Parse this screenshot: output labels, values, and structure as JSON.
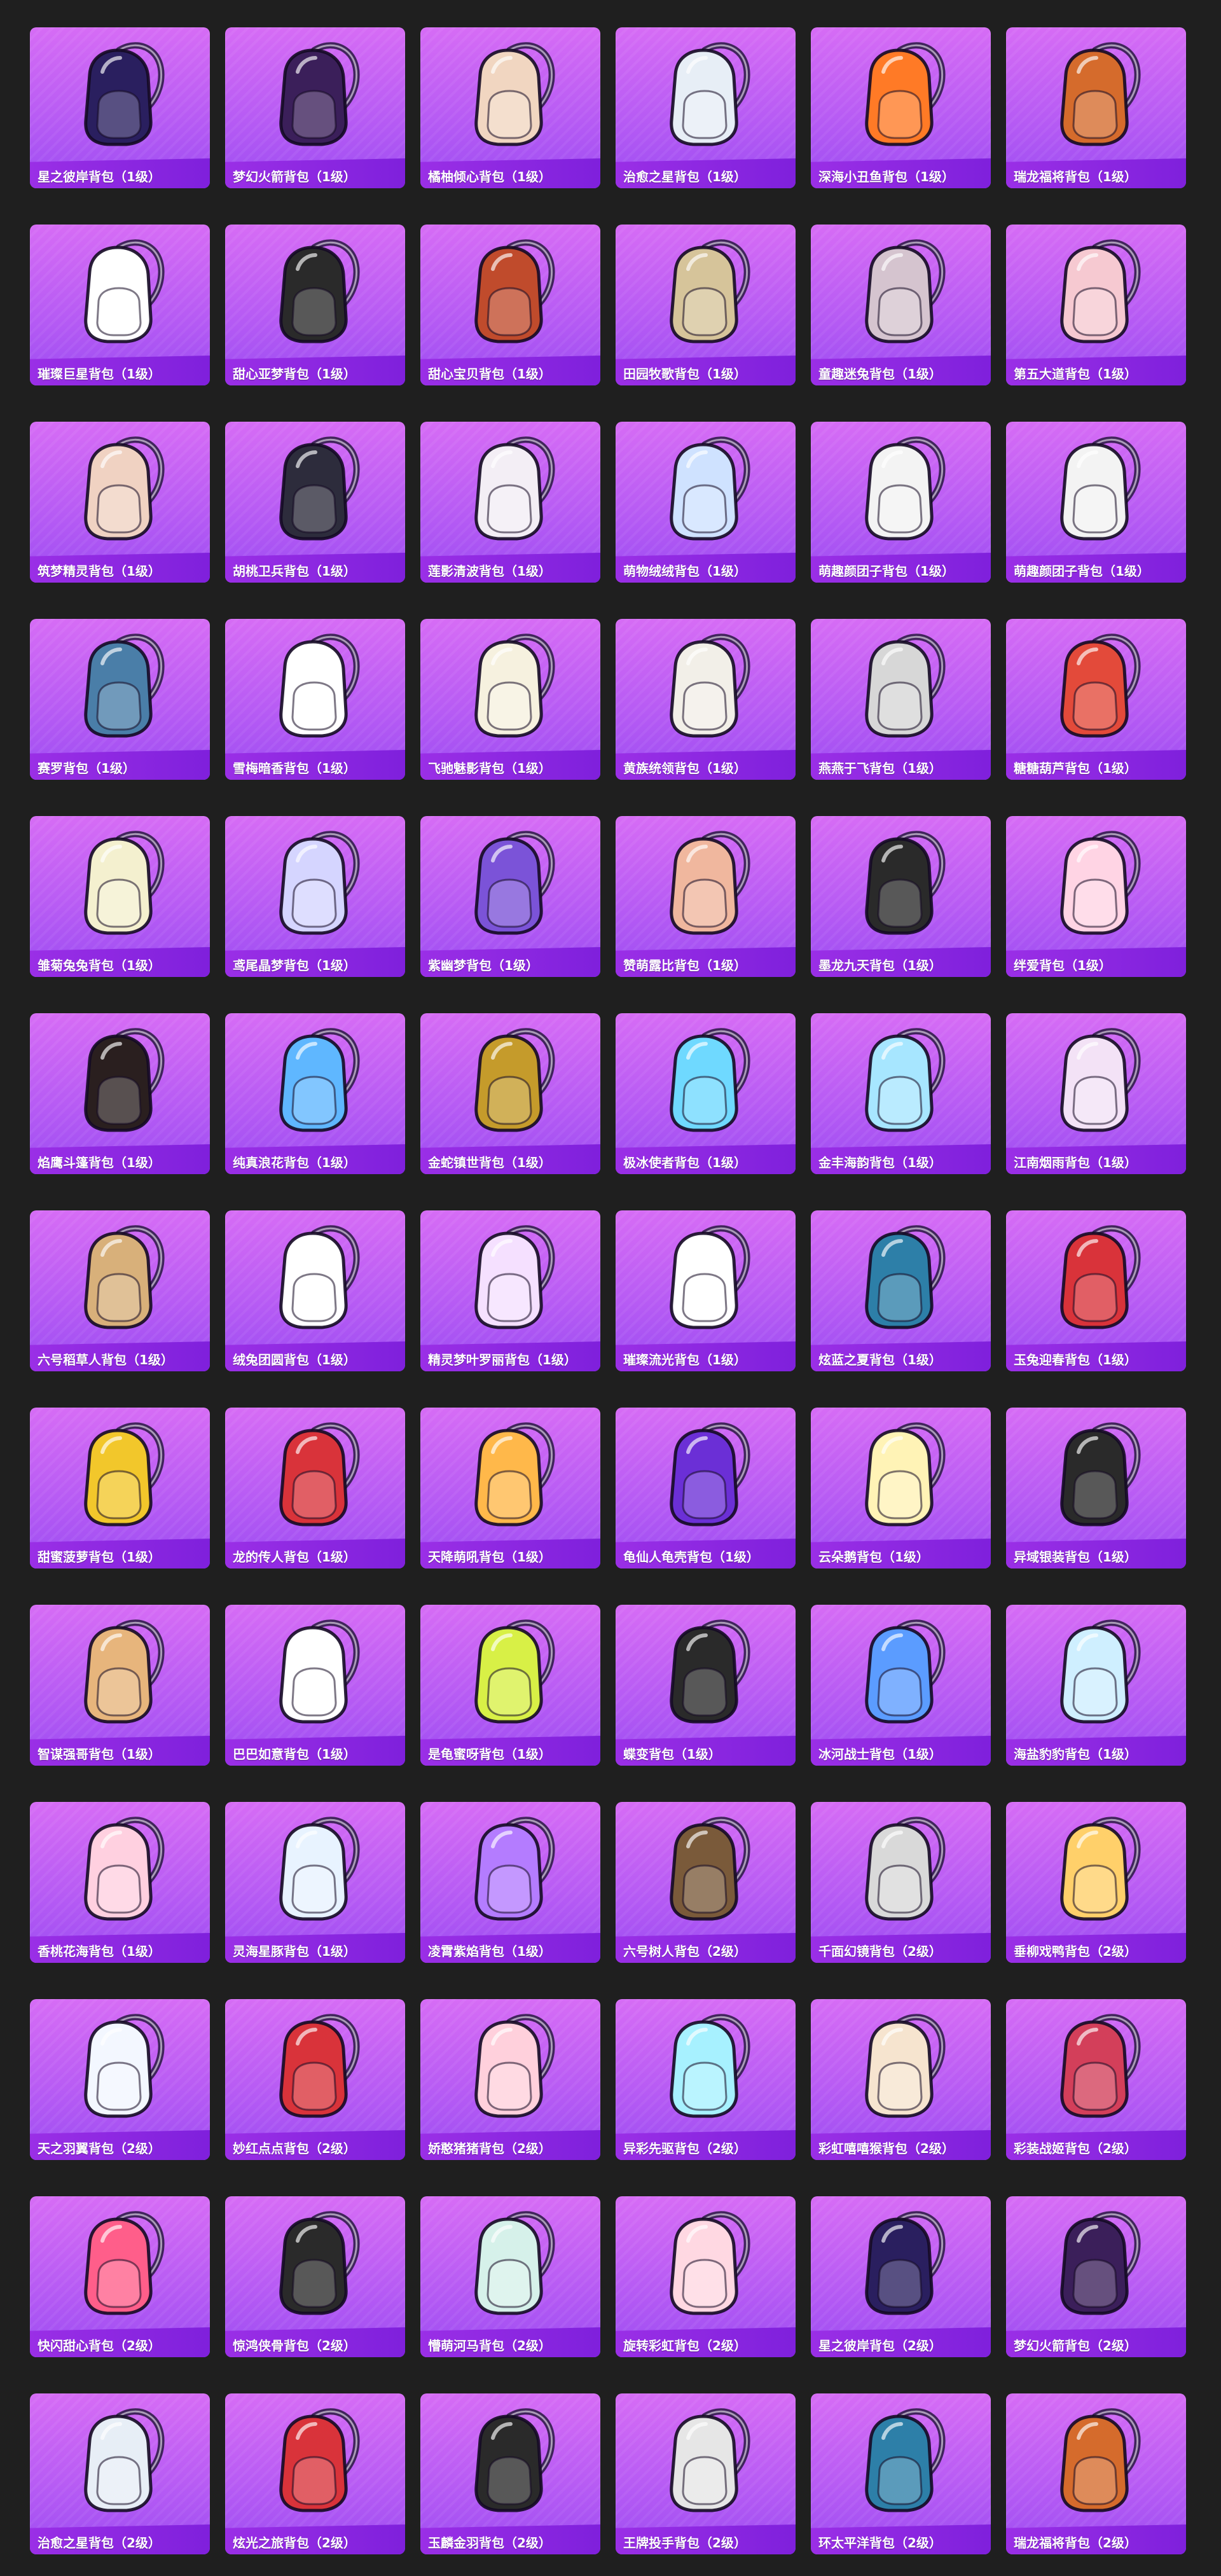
{
  "app": {
    "title": ""
  },
  "items": [
    {
      "label": "星之彼岸背包（1级）",
      "icon": "backpack-icon",
      "color": "#2a1f5f"
    },
    {
      "label": "梦幻火箭背包（1级）",
      "icon": "backpack-icon",
      "color": "#3b1f5a"
    },
    {
      "label": "橘柚倾心背包（1级）",
      "icon": "backpack-icon",
      "color": "#f1d6c1"
    },
    {
      "label": "治愈之星背包（1级）",
      "icon": "backpack-icon",
      "color": "#e7eef6"
    },
    {
      "label": "深海小丑鱼背包（1级）",
      "icon": "backpack-icon",
      "color": "#ff7a26"
    },
    {
      "label": "瑞龙福将背包（1级）",
      "icon": "backpack-icon",
      "color": "#d56b2c"
    },
    {
      "label": "璀璨巨星背包（1级）",
      "icon": "backpack-icon",
      "color": "#ffffff"
    },
    {
      "label": "甜心亚梦背包（1级）",
      "icon": "backpack-icon",
      "color": "#2a2a2a"
    },
    {
      "label": "甜心宝贝背包（1级）",
      "icon": "backpack-icon",
      "color": "#c04b2c"
    },
    {
      "label": "田园牧歌背包（1级）",
      "icon": "backpack-icon",
      "color": "#d6c49a"
    },
    {
      "label": "童趣迷兔背包（1级）",
      "icon": "backpack-icon",
      "color": "#d5c4cf"
    },
    {
      "label": "第五大道背包（1级）",
      "icon": "backpack-icon",
      "color": "#f6c9d1"
    },
    {
      "label": "筑梦精灵背包（1级）",
      "icon": "backpack-icon",
      "color": "#f0d2c2"
    },
    {
      "label": "胡桃卫兵背包（1级）",
      "icon": "backpack-icon",
      "color": "#2d2c3c"
    },
    {
      "label": "莲影清波背包（1级）",
      "icon": "backpack-icon",
      "color": "#f3eef5"
    },
    {
      "label": "萌物绒绒背包（1级）",
      "icon": "backpack-icon",
      "color": "#cfe2ff"
    },
    {
      "label": "萌趣颜团子背包（1级）",
      "icon": "backpack-icon",
      "color": "#f3f3f3"
    },
    {
      "label": "萌趣颜团子背包（1级）",
      "icon": "backpack-icon",
      "color": "#f3f3f3"
    },
    {
      "label": "赛罗背包（1级）",
      "icon": "backpack-icon",
      "color": "#4a7ea8"
    },
    {
      "label": "雪梅暗香背包（1级）",
      "icon": "backpack-icon",
      "color": "#ffffff"
    },
    {
      "label": "飞驰魅影背包（1级）",
      "icon": "backpack-icon",
      "color": "#f6f1df"
    },
    {
      "label": "黄族统领背包（1级）",
      "icon": "backpack-icon",
      "color": "#f2efe8"
    },
    {
      "label": "燕燕于飞背包（1级）",
      "icon": "backpack-icon",
      "color": "#d7d7d7"
    },
    {
      "label": "糖糖葫芦背包（1级）",
      "icon": "backpack-icon",
      "color": "#e34a3a"
    },
    {
      "label": "雏菊兔兔背包（1级）",
      "icon": "backpack-icon",
      "color": "#f4f0cf"
    },
    {
      "label": "鸢尾晶梦背包（1级）",
      "icon": "backpack-icon",
      "color": "#d5d5ff"
    },
    {
      "label": "紫幽梦背包（1级）",
      "icon": "backpack-icon",
      "color": "#7b53d8"
    },
    {
      "label": "赞萌露比背包（1级）",
      "icon": "backpack-icon",
      "color": "#f0b79e"
    },
    {
      "label": "墨龙九天背包（1级）",
      "icon": "backpack-icon",
      "color": "#2a2a2a"
    },
    {
      "label": "绊爱背包（1级）",
      "icon": "backpack-icon",
      "color": "#ffd4e4"
    },
    {
      "label": "焰鹰斗篷背包（1级）",
      "icon": "backpack-icon",
      "color": "#2a1f1f"
    },
    {
      "label": "纯真浪花背包（1级）",
      "icon": "backpack-icon",
      "color": "#5fb7ff"
    },
    {
      "label": "金蛇镇世背包（1级）",
      "icon": "backpack-icon",
      "color": "#c59b2b"
    },
    {
      "label": "极冰使者背包（1级）",
      "icon": "backpack-icon",
      "color": "#6fd9ff"
    },
    {
      "label": "金丰海韵背包（1级）",
      "icon": "backpack-icon",
      "color": "#a7e6ff"
    },
    {
      "label": "江南烟雨背包（1级）",
      "icon": "backpack-icon",
      "color": "#f3e2f6"
    },
    {
      "label": "六号稻草人背包（1级）",
      "icon": "backpack-icon",
      "color": "#d8b07a"
    },
    {
      "label": "绒兔团圆背包（1级）",
      "icon": "backpack-icon",
      "color": "#ffffff"
    },
    {
      "label": "精灵梦叶罗丽背包（1级）",
      "icon": "backpack-icon",
      "color": "#f5e0ff"
    },
    {
      "label": "璀璨流光背包（1级）",
      "icon": "backpack-icon",
      "color": "#ffffff"
    },
    {
      "label": "炫蓝之夏背包（1级）",
      "icon": "backpack-icon",
      "color": "#2d7fa8"
    },
    {
      "label": "玉兔迎春背包（1级）",
      "icon": "backpack-icon",
      "color": "#d9333a"
    },
    {
      "label": "甜蜜菠萝背包（1级）",
      "icon": "backpack-icon",
      "color": "#f2c72b"
    },
    {
      "label": "龙的传人背包（1级）",
      "icon": "backpack-icon",
      "color": "#d9333a"
    },
    {
      "label": "天降萌吼背包（1级）",
      "icon": "backpack-icon",
      "color": "#ffb84a"
    },
    {
      "label": "龟仙人龟壳背包（1级）",
      "icon": "backpack-icon",
      "color": "#6b2fd6"
    },
    {
      "label": "云朵鹅背包（1级）",
      "icon": "backpack-icon",
      "color": "#fff3b6"
    },
    {
      "label": "异域银装背包（1级）",
      "icon": "backpack-icon",
      "color": "#2a2a2a"
    },
    {
      "label": "智谋强哥背包（1级）",
      "icon": "backpack-icon",
      "color": "#e7b57c"
    },
    {
      "label": "巴巴如意背包（1级）",
      "icon": "backpack-icon",
      "color": "#ffffff"
    },
    {
      "label": "是龟蜜呀背包（1级）",
      "icon": "backpack-icon",
      "color": "#d8f046"
    },
    {
      "label": "蝶变背包（1级）",
      "icon": "backpack-icon",
      "color": "#2a2a2a"
    },
    {
      "label": "冰河战士背包（1级）",
      "icon": "backpack-icon",
      "color": "#5b9cff"
    },
    {
      "label": "海盐豹豹背包（1级）",
      "icon": "backpack-icon",
      "color": "#cfefff"
    },
    {
      "label": "香桃花海背包（1级）",
      "icon": "backpack-icon",
      "color": "#ffd0e0"
    },
    {
      "label": "灵海星豚背包（1级）",
      "icon": "backpack-icon",
      "color": "#e8f3ff"
    },
    {
      "label": "凌霄紫焰背包（1级）",
      "icon": "backpack-icon",
      "color": "#b47cff"
    },
    {
      "label": "六号树人背包（2级）",
      "icon": "backpack-icon",
      "color": "#7a5a3a"
    },
    {
      "label": "千面幻镜背包（2级）",
      "icon": "backpack-icon",
      "color": "#d9d9d9"
    },
    {
      "label": "垂柳戏鸭背包（2级）",
      "icon": "backpack-icon",
      "color": "#ffd06a"
    },
    {
      "label": "天之羽翼背包（2级）",
      "icon": "backpack-icon",
      "color": "#f3f7ff"
    },
    {
      "label": "妙红点点背包（2级）",
      "icon": "backpack-icon",
      "color": "#d9333a"
    },
    {
      "label": "娇憨猪猪背包（2级）",
      "icon": "backpack-icon",
      "color": "#ffd0dc"
    },
    {
      "label": "异彩先驱背包（2级）",
      "icon": "backpack-icon",
      "color": "#a7f1ff"
    },
    {
      "label": "彩虹嘻嘻猴背包（2级）",
      "icon": "backpack-icon",
      "color": "#f6e4cf"
    },
    {
      "label": "彩装战姬背包（2级）",
      "icon": "backpack-icon",
      "color": "#d33f5a"
    },
    {
      "label": "快闪甜心背包（2级）",
      "icon": "backpack-icon",
      "color": "#ff5e8a"
    },
    {
      "label": "惊鸿侠骨背包（2级）",
      "icon": "backpack-icon",
      "color": "#2a2a2a"
    },
    {
      "label": "懵萌河马背包（2级）",
      "icon": "backpack-icon",
      "color": "#d6f1ea"
    },
    {
      "label": "旋转彩虹背包（2级）",
      "icon": "backpack-icon",
      "color": "#ffd8e2"
    },
    {
      "label": "星之彼岸背包（2级）",
      "icon": "backpack-icon",
      "color": "#2a1f5f"
    },
    {
      "label": "梦幻火箭背包（2级）",
      "icon": "backpack-icon",
      "color": "#3b1f5a"
    },
    {
      "label": "治愈之星背包（2级）",
      "icon": "backpack-icon",
      "color": "#e7eef6"
    },
    {
      "label": "炫光之旅背包（2级）",
      "icon": "backpack-icon",
      "color": "#d9333a"
    },
    {
      "label": "玉麟金羽背包（2级）",
      "icon": "backpack-icon",
      "color": "#2a2a2a"
    },
    {
      "label": "王牌投手背包（2级）",
      "icon": "backpack-icon",
      "color": "#e6e6e6"
    },
    {
      "label": "环太平洋背包（2级）",
      "icon": "backpack-icon",
      "color": "#2d7fa8"
    },
    {
      "label": "瑞龙福将背包（2级）",
      "icon": "backpack-icon",
      "color": "#d56b2c"
    }
  ]
}
